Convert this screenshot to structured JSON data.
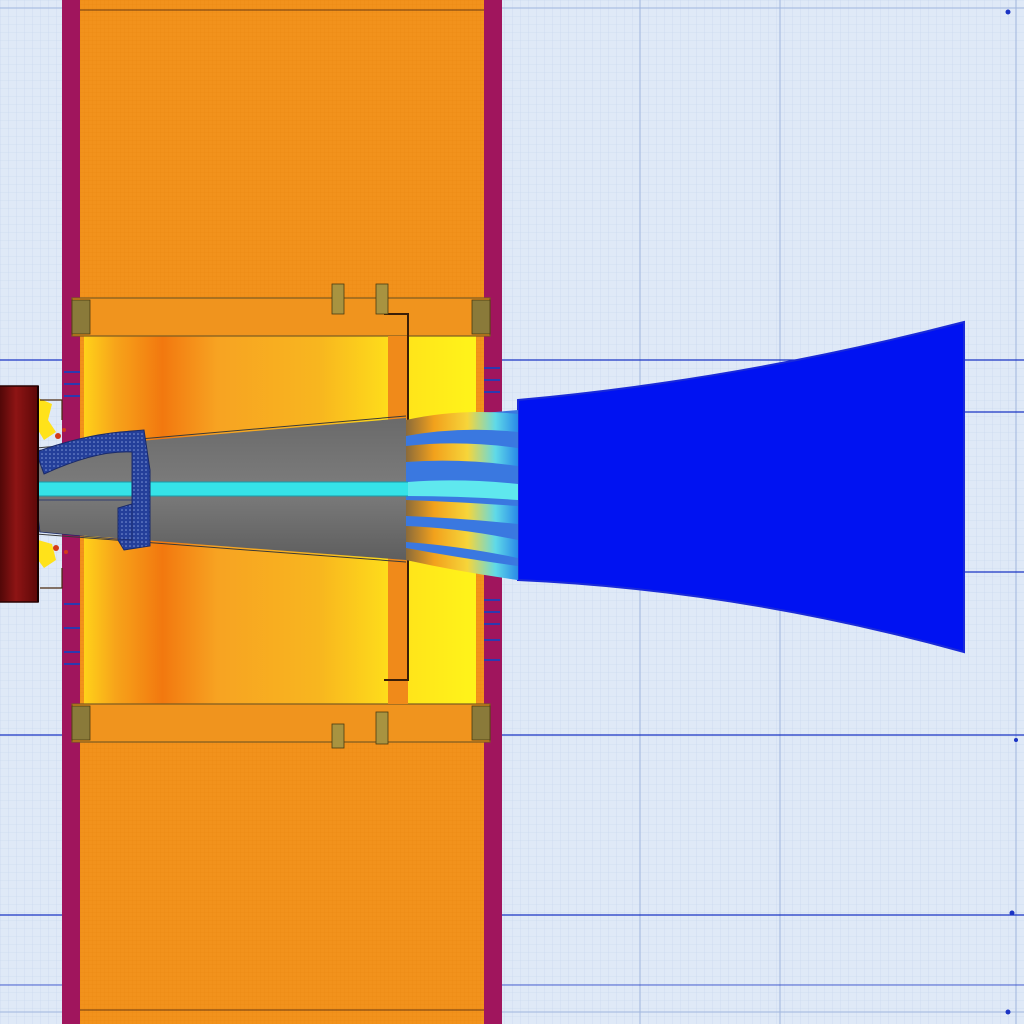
{
  "colors": {
    "background": "#dfe9f7",
    "grid_minor": "#b9cbe8",
    "grid_major": "#8aa3d4",
    "frame_border": "#a0155d",
    "wall_fill": "#f2921c",
    "hot_core": "#fff21a",
    "hot_edge": "#f2780f",
    "shaft_grey": "#717171",
    "shaft_dark": "#5a5a5a",
    "core_channel": "#35e3e8",
    "plume_blue": "#0012f2",
    "plume_edge": "#1a2ad8",
    "hub_red": "#8a0f10",
    "hub_dark": "#3c0404",
    "mesh_navy": "#243f9a",
    "bolt_olive": "#8a7a3a",
    "reference_line": "#1b34c4",
    "dark_line": "#4a2a10"
  },
  "components": {
    "frame": {
      "icon": "rectangular-frame"
    },
    "cavity": {
      "icon": "heated-cavity"
    },
    "shaft": {
      "icon": "tapered-shaft"
    },
    "core": {
      "icon": "axial-core-channel"
    },
    "plume": {
      "icon": "flared-plume"
    },
    "hub": {
      "icon": "inlet-hub"
    },
    "collar": {
      "icon": "mesh-collar"
    },
    "bolts": {
      "icon": "fastener"
    },
    "grid": {
      "icon": "background-grid"
    }
  }
}
